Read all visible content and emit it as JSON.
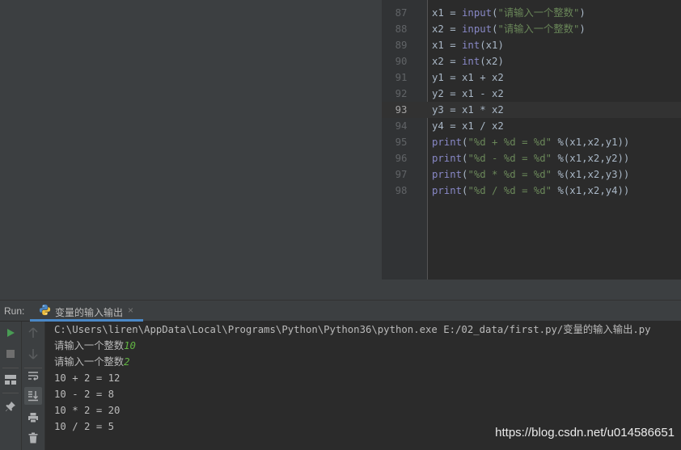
{
  "editor": {
    "lines": [
      {
        "num": "87",
        "code": "x1 = input(\"请输入一个整数\")"
      },
      {
        "num": "88",
        "code": "x2 = input(\"请输入一个整数\")"
      },
      {
        "num": "89",
        "code": "x1 = int(x1)"
      },
      {
        "num": "90",
        "code": "x2 = int(x2)"
      },
      {
        "num": "91",
        "code": "y1 = x1 + x2"
      },
      {
        "num": "92",
        "code": "y2 = x1 - x2"
      },
      {
        "num": "93",
        "code": "y3 = x1 * x2"
      },
      {
        "num": "94",
        "code": "y4 = x1 / x2"
      },
      {
        "num": "95",
        "code": "print(\"%d + %d = %d\" %(x1,x2,y1))"
      },
      {
        "num": "96",
        "code": "print(\"%d - %d = %d\" %(x1,x2,y2))"
      },
      {
        "num": "97",
        "code": "print(\"%d * %d = %d\" %(x1,x2,y3))"
      },
      {
        "num": "98",
        "code": "print(\"%d / %d = %d\" %(x1,x2,y4))"
      }
    ],
    "current_line": "93"
  },
  "run_panel": {
    "label": "Run:",
    "tab_label": "变量的输入输出",
    "tab_close": "×",
    "tab_icon": "python-icon"
  },
  "toolbar": {
    "col1": [
      "run-icon",
      "stop-icon",
      "layout-icon",
      "pin-icon"
    ],
    "col2": [
      "up-arrow-icon",
      "down-arrow-icon",
      "soft-wrap-icon",
      "scroll-to-end-icon",
      "print-icon",
      "trash-icon"
    ]
  },
  "console": {
    "command": "C:\\Users\\liren\\AppData\\Local\\Programs\\Python\\Python36\\python.exe E:/02_data/first.py/变量的输入输出.py",
    "prompt1": "请输入一个整数",
    "input1": "10",
    "prompt2": "请输入一个整数",
    "input2": "2",
    "out1": "10 + 2 = 12",
    "out2": "10 - 2 = 8",
    "out3": "10 * 2 = 20",
    "out4": "10 / 2 = 5"
  },
  "watermark": "https://blog.csdn.net/u014586651",
  "colors": {
    "accent": "#4a88c7",
    "run_green": "#499c54",
    "string": "#6a8759",
    "builtin": "#8888c6",
    "user_input": "#62b543"
  }
}
